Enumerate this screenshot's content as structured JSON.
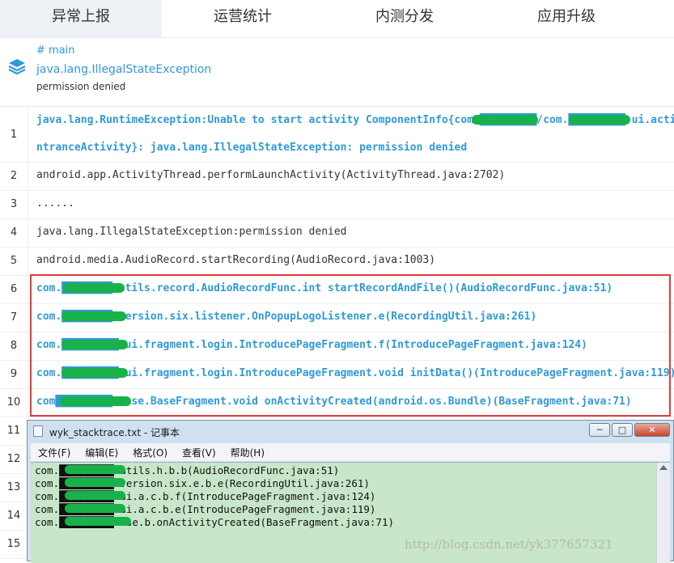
{
  "tabs": [
    {
      "label": "异常上报",
      "active": true
    },
    {
      "label": "运营统计",
      "active": false
    },
    {
      "label": "内测分发",
      "active": false
    },
    {
      "label": "应用升级",
      "active": false
    }
  ],
  "exception": {
    "tag": "# main",
    "name": "java.lang.IllegalStateException",
    "message": "permission denied",
    "icon": "layers-icon"
  },
  "lines": [
    {
      "no": "1",
      "text": "java.lang.RuntimeException:Unable to start activity ComponentInfo{com.█████████/com.█████████.ui.acti",
      "text2": "ntranceActivity}: java.lang.IllegalStateException: permission denied",
      "style": "blue"
    },
    {
      "no": "2",
      "text": "android.app.ActivityThread.performLaunchActivity(ActivityThread.java:2702)",
      "style": "black"
    },
    {
      "no": "3",
      "text": "......",
      "style": "black"
    },
    {
      "no": "4",
      "text": "java.lang.IllegalStateException:permission denied",
      "style": "black"
    },
    {
      "no": "5",
      "text": "android.media.AudioRecord.startRecording(AudioRecord.java:1003)",
      "style": "black"
    },
    {
      "no": "6",
      "text": "com.████████.utils.record.AudioRecordFunc.int startRecordAndFile()(AudioRecordFunc.java:51)",
      "style": "blue"
    },
    {
      "no": "7",
      "text": "com.████████.version.six.listener.OnPopupLogoListener.e(RecordingUtil.java:261)",
      "style": "blue"
    },
    {
      "no": "8",
      "text": "com.█████████.ui.fragment.login.IntroducePageFragment.f(IntroducePageFragment.java:124)",
      "style": "blue"
    },
    {
      "no": "9",
      "text": "com.█████████.ui.fragment.login.IntroducePageFragment.void initData()(IntroducePageFragment.java:119)",
      "style": "blue"
    },
    {
      "no": "10",
      "text": "com█████████.base.BaseFragment.void onActivityCreated(android.os.Bundle)(BaseFragment.java:71)",
      "style": "blue"
    },
    {
      "no": "11",
      "text": "",
      "style": "black"
    },
    {
      "no": "12",
      "text": "",
      "style": "black"
    },
    {
      "no": "13",
      "text": "",
      "style": "black"
    },
    {
      "no": "14",
      "text": "",
      "style": "black"
    },
    {
      "no": "15",
      "text": "",
      "style": "black"
    }
  ],
  "notepad": {
    "title": "wyk_stacktrace.txt - 记事本",
    "controls": {
      "minimize": "─",
      "maximize": "□",
      "close": "✕"
    },
    "menu": [
      "文件(F)",
      "编辑(E)",
      "格式(O)",
      "查看(V)",
      "帮助(H)"
    ],
    "lines": [
      "com.█████████.utils.h.b.b(AudioRecordFunc.java:51)",
      "com.█████████.version.six.e.b.e(RecordingUtil.java:261)",
      "com.█████████.ui.a.c.b.f(IntroducePageFragment.java:124)",
      "com.█████████.ui.a.c.b.e(IntroducePageFragment.java:119)",
      "com.█████████base.b.onActivityCreated(BaseFragment.java:71)"
    ]
  },
  "watermark": "http://blog.csdn.net/yk377657321",
  "colors": {
    "link_blue": "#2f9ad8",
    "highlight_red": "#e23b3b",
    "redaction_green": "#19b24a",
    "notepad_bg": "#c8e6ca"
  }
}
